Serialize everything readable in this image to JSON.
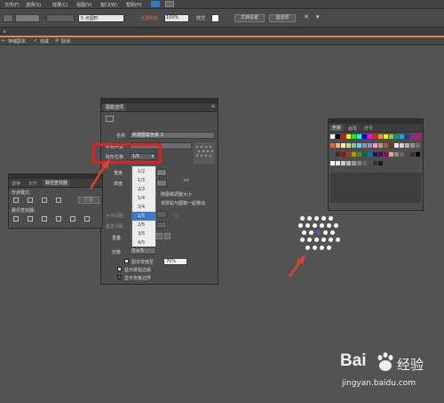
{
  "menubar": {
    "items": [
      "文件(F)",
      "选择(S)",
      "效果(C)",
      "视图(V)",
      "窗口(W)",
      "帮助(H)"
    ]
  },
  "toolbar": {
    "stroke_size": "5 点圆形",
    "opacity_label": "不透明度",
    "opacity_value": "100%",
    "style_label": "样式",
    "doc_setup_button": "文档设置",
    "preferences_button": "首选项"
  },
  "options_bar": {
    "back_label": "存储副本",
    "done_label": "完成",
    "cancel_label": "取消"
  },
  "pattern_panel": {
    "tab_title": "图案选项",
    "name_label": "名称",
    "name_value": "新建图案色板 3",
    "tile_type_label": "拼贴类型",
    "offset_label": "砖形位移",
    "offset_value": "1/5",
    "width_label": "宽度",
    "height_label": "高度",
    "scale_label": "随图稿调整大小",
    "move_label": "将拼贴与图稿一起移动",
    "h_spacing_label": "水平间距",
    "v_spacing_label": "垂直间距",
    "overlap_label": "重叠",
    "copies_label": "份数",
    "copies_value": "5 x 5",
    "dim_value": "70%",
    "dim_label": "副本变暗至",
    "show_edge_label": "显示拼贴边缘",
    "show_swatch_label": "显示色板边界",
    "offset_options": [
      "1/2",
      "1/3",
      "2/3",
      "1/4",
      "3/4",
      "1/5",
      "2/5",
      "3/5",
      "4/5"
    ],
    "offset_selected_index": 5
  },
  "pathfinder_panel": {
    "tabs": [
      "变换",
      "对齐",
      "路径查找器"
    ],
    "shape_modes_label": "形状模式:",
    "pathfinders_label": "路径查找器:",
    "expand_button": "扩展"
  },
  "swatches_panel": {
    "tabs": [
      "色板",
      "画笔",
      "符号"
    ]
  },
  "watermark": {
    "brand": "Bai",
    "brand_suffix": "经验",
    "url": "jingyan.baidu.com"
  },
  "colors": {
    "highlight": "#e32020",
    "arrow": "#e04030",
    "selection": "#3f78c6",
    "workspace": "#535353"
  }
}
